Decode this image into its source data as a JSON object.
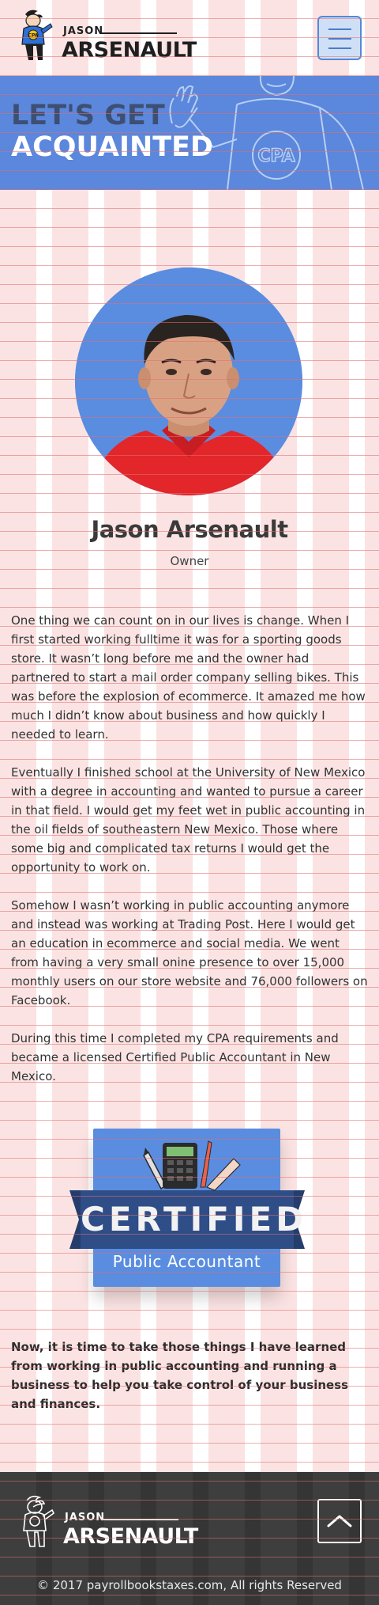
{
  "header": {
    "logo": {
      "first_name": "JASON",
      "last_name": "ARSENAULT",
      "mascot_badge": "CPA"
    },
    "menu_icon": "hamburger-icon"
  },
  "hero": {
    "title_line1": "LET'S GET",
    "title_line2": "ACQUAINTED",
    "illustration_text": "CPA"
  },
  "profile": {
    "name": "Jason Arsenault",
    "role": "Owner"
  },
  "bio": {
    "paragraphs": [
      "One thing we can count on in our lives is change. When I first started working fulltime it was for a sporting goods store. It wasn’t long before me and the owner had partnered to start a mail order company selling bikes. This was before the explosion of ecommerce. It amazed me how much I didn’t know about business and how quickly I needed to learn.",
      "Eventually I finished school at the University of New Mexico with a degree in accounting and wanted to pursue a career in that field. I would get my feet wet in public accounting in the oil fields of southeastern New Mexico. Those where some big and complicated tax returns I would get the opportunity to work on.",
      "Somehow I wasn’t working in public accounting anymore and instead was working at Trading Post. Here I would get an education in ecommerce and social media. We went from having a very small onine presence to over 15,000 monthly users on our store website and 76,000 followers on Facebook.",
      "During this time I completed my CPA requirements and became a licensed Certified Public Accountant in New Mexico."
    ]
  },
  "badge": {
    "title": "CERTIFIED",
    "subtitle": "Public Accountant"
  },
  "cta": {
    "text": "Now, it is time to take those things I have learned from working in public accounting and running a business to help you take control of your business and finances."
  },
  "footer": {
    "logo": {
      "first_name": "JASON",
      "last_name": "ARSENAULT"
    },
    "back_to_top_icon": "chevron-up-icon",
    "copyright": "© 2017 payrollbookstaxes.com, All rights Reserved"
  },
  "colors": {
    "brand_blue": "#5b87dc",
    "navy": "#2f4d87",
    "dark": "#3a3a3a",
    "stripe_pink": "#fbe3e3"
  }
}
